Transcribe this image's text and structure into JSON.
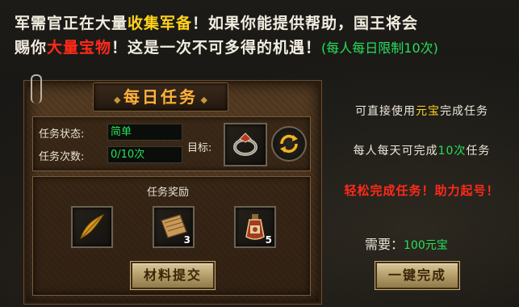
{
  "intro": {
    "line1_a": "军需官正在大量",
    "line1_hl": "收集军备",
    "line1_b": "！如果你能提供帮助，国王将会",
    "line2_a": "赐你",
    "line2_hl": "大量宝物",
    "line2_b": "！这是一次不可多得的机遇！",
    "line2_note": "(每人每日限制10次)"
  },
  "panel": {
    "title": "每日任务",
    "status_label": "任务状态:",
    "status_value": "简单",
    "count_label": "任务次数:",
    "count_value": "0/10次",
    "target_label": "目标:",
    "target_icon": "ring-icon",
    "refresh_icon": "refresh-icon",
    "rewards_title": "任务奖励",
    "rewards": [
      {
        "icon": "golden-feather-icon",
        "count": ""
      },
      {
        "icon": "scroll-icon",
        "count": "3"
      },
      {
        "icon": "potion-icon",
        "count": "5"
      }
    ],
    "submit_button": "材料提交"
  },
  "side": {
    "line1_a": "可直接使用",
    "line1_hl": "元宝",
    "line1_b": "完成任务",
    "line2_a": "每人每天可完成",
    "line2_hl": "10次",
    "line2_b": "任务",
    "line3": "轻松完成任务！助力起号！",
    "cost_label": "需要：",
    "cost_value": "100元宝",
    "complete_button": "一键完成"
  },
  "colors": {
    "highlight_yellow": "#ffd21c",
    "highlight_red": "#ff2a1a",
    "highlight_green": "#26e05a",
    "title_orange": "#ffb23a"
  }
}
